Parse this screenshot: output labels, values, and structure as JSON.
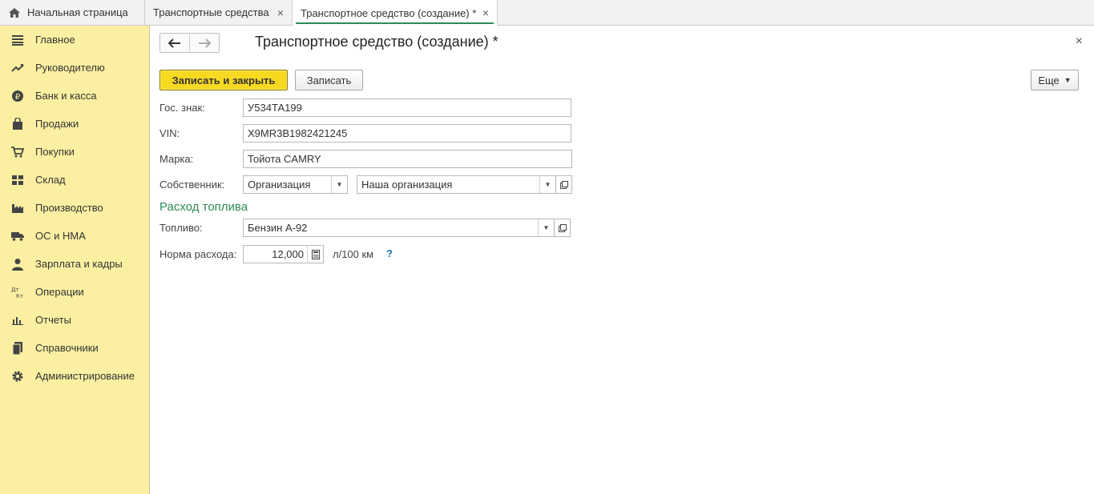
{
  "tabs": {
    "home": {
      "label": "Начальная страница",
      "icon": "home-icon"
    },
    "items": [
      {
        "label": "Транспортные средства",
        "close": "×"
      },
      {
        "label": "Транспортное средство (создание) *",
        "close": "×",
        "active": true
      }
    ]
  },
  "sidebar": {
    "items": [
      {
        "label": "Главное",
        "icon": "menu-icon"
      },
      {
        "label": "Руководителю",
        "icon": "trend-icon"
      },
      {
        "label": "Банк и касса",
        "icon": "ruble-icon"
      },
      {
        "label": "Продажи",
        "icon": "bag-icon"
      },
      {
        "label": "Покупки",
        "icon": "cart-icon"
      },
      {
        "label": "Склад",
        "icon": "grid-icon"
      },
      {
        "label": "Производство",
        "icon": "factory-icon"
      },
      {
        "label": "ОС и НМА",
        "icon": "truck-icon"
      },
      {
        "label": "Зарплата и кадры",
        "icon": "person-icon"
      },
      {
        "label": "Операции",
        "icon": "dt-kt-icon"
      },
      {
        "label": "Отчеты",
        "icon": "bar-chart-icon"
      },
      {
        "label": "Справочники",
        "icon": "book-icon"
      },
      {
        "label": "Администрирование",
        "icon": "gear-icon"
      }
    ],
    "dt_kt": {
      "dt": "Дт",
      "kt": "Кт"
    }
  },
  "form": {
    "title": "Транспортное средство (создание) *",
    "close": "×",
    "buttons": {
      "save_close": "Записать и закрыть",
      "save": "Записать",
      "more": "Еще"
    },
    "fields": {
      "plate": {
        "label": "Гос. знак:",
        "value": "У534ТА199"
      },
      "vin": {
        "label": "VIN:",
        "value": "X9MR3B1982421245"
      },
      "brand": {
        "label": "Марка:",
        "value": "Тойота CAMRY"
      },
      "owner": {
        "label": "Собственник:",
        "type_value": "Организация",
        "value": "Наша организация"
      }
    },
    "fuel_section": {
      "title": "Расход топлива",
      "fuel": {
        "label": "Топливо:",
        "value": "Бензин А-92"
      },
      "rate": {
        "label": "Норма расхода:",
        "value": "12,000",
        "unit": "л/100 км",
        "help": "?"
      }
    }
  },
  "colors": {
    "sidebar_bg": "#fbf0a2",
    "primary_button": "#f7d922",
    "section_title": "#2e8b57",
    "active_tab_underline": "#2e8b57",
    "help_link": "#1a6fb5"
  }
}
